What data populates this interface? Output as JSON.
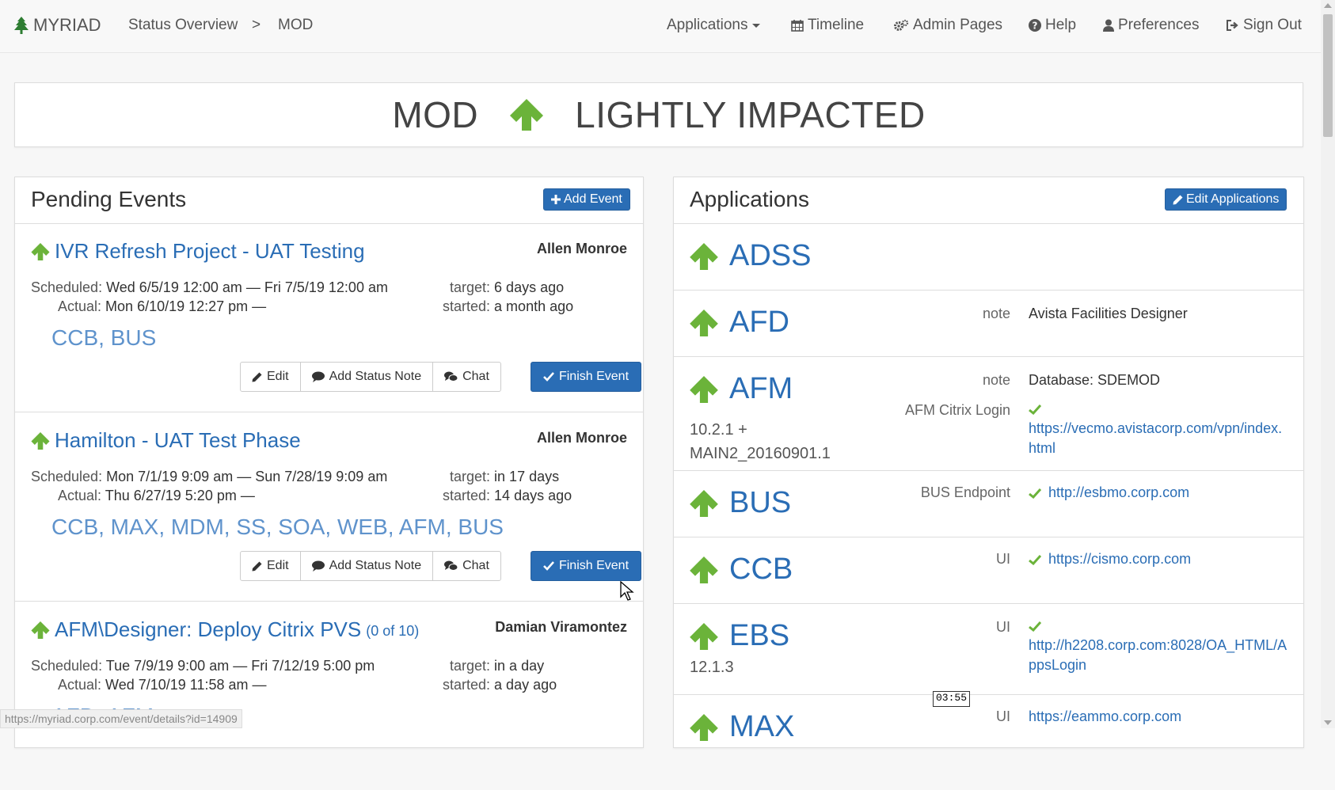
{
  "navbar": {
    "brand": "MYRIAD",
    "breadcrumb": [
      "Status Overview",
      ">",
      "MOD"
    ],
    "items": [
      "Applications",
      "Timeline",
      "Admin Pages",
      "Help",
      "Preferences",
      "Sign Out"
    ]
  },
  "status": {
    "system": "MOD",
    "state": "LIGHTLY IMPACTED"
  },
  "pending": {
    "title": "Pending Events",
    "add_label": "Add Event",
    "events": [
      {
        "title": "IVR Refresh Project - UAT Testing",
        "count": "",
        "owner": "Allen Monroe",
        "scheduled_label": "Scheduled:",
        "scheduled": "Wed 6/5/19 12:00 am — Fri 7/5/19 12:00 am",
        "actual_label": "Actual:",
        "actual": "Mon 6/10/19 12:27 pm —",
        "target_label": "target:",
        "target": "6 days ago",
        "started_label": "started:",
        "started": "a month ago",
        "apps": "CCB, BUS"
      },
      {
        "title": "Hamilton - UAT Test Phase",
        "count": "",
        "owner": "Allen Monroe",
        "scheduled_label": "Scheduled:",
        "scheduled": "Mon 7/1/19 9:09 am — Sun 7/28/19 9:09 am",
        "actual_label": "Actual:",
        "actual": "Thu 6/27/19 5:20 pm —",
        "target_label": "target:",
        "target": "in 17 days",
        "started_label": "started:",
        "started": "14 days ago",
        "apps": "CCB, MAX, MDM, SS, SOA, WEB, AFM, BUS"
      },
      {
        "title": "AFM\\Designer: Deploy Citrix PVS",
        "count": "(0 of 10)",
        "owner": "Damian Viramontez",
        "scheduled_label": "Scheduled:",
        "scheduled": "Tue 7/9/19 9:00 am — Fri 7/12/19 5:00 pm",
        "actual_label": "Actual:",
        "actual": "Wed 7/10/19 11:58 am —",
        "target_label": "target:",
        "target": "in a day",
        "started_label": "started:",
        "started": "a day ago",
        "apps": "AFD, AFM"
      }
    ],
    "buttons": {
      "edit": "Edit",
      "note": "Add Status Note",
      "chat": "Chat",
      "finish": "Finish Event"
    }
  },
  "applications": {
    "title": "Applications",
    "edit_label": "Edit Applications",
    "items": [
      {
        "name": "ADSS",
        "version": "",
        "fields": []
      },
      {
        "name": "AFD",
        "version": "",
        "fields": [
          {
            "key": "note",
            "value": "Avista Facilities Designer",
            "link": false,
            "check": false
          }
        ]
      },
      {
        "name": "AFM",
        "version": "10.2.1 + MAIN2_20160901.1",
        "fields": [
          {
            "key": "note",
            "value": "Database: SDEMOD",
            "link": false,
            "check": false
          },
          {
            "key": "AFM Citrix Login",
            "value": "https://vecmo.avistacorp.com/vpn/index.html",
            "link": true,
            "check": true
          }
        ]
      },
      {
        "name": "BUS",
        "version": "",
        "fields": [
          {
            "key": "BUS Endpoint",
            "value": "http://esbmo.corp.com",
            "link": true,
            "check": true
          }
        ]
      },
      {
        "name": "CCB",
        "version": "",
        "fields": [
          {
            "key": "UI",
            "value": "https://cismo.corp.com",
            "link": true,
            "check": true
          }
        ]
      },
      {
        "name": "EBS",
        "version": "12.1.3",
        "fields": [
          {
            "key": "UI",
            "value": "http://h2208.corp.com:8028/OA_HTML/AppsLogin",
            "link": true,
            "check": true
          }
        ]
      },
      {
        "name": "MAX",
        "version": "",
        "fields": [
          {
            "key": "UI",
            "value": "https://eammo.corp.com",
            "link": true,
            "check": false
          }
        ]
      }
    ]
  },
  "statusbar_url": "https://myriad.corp.com/event/details?id=14909",
  "timer": "03:55",
  "colors": {
    "accent": "#2a6db5",
    "up_arrow": "#6bb33a",
    "apps_link": "#5f93cc"
  }
}
